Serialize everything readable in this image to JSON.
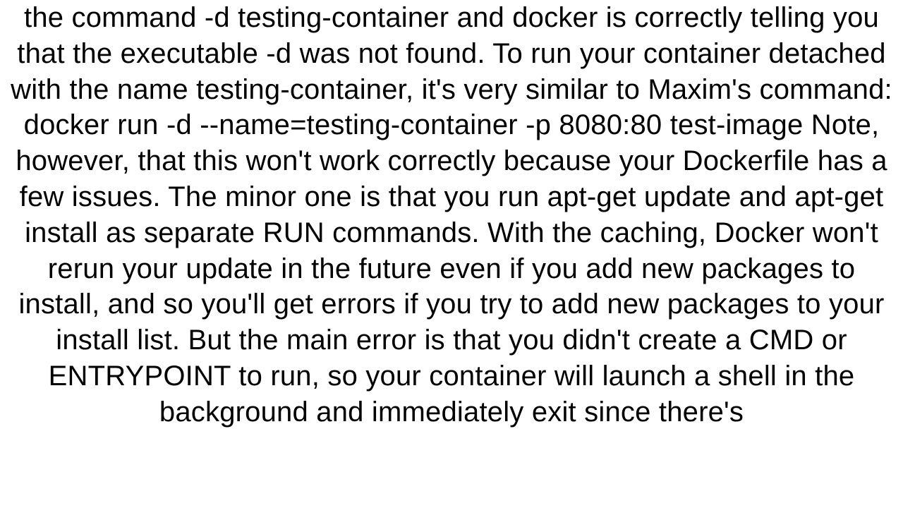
{
  "document": {
    "body_text": "the command -d testing-container and docker is correctly telling you that the executable -d was not found. To run your container detached with the name testing-container, it's very similar to Maxim's command: docker run -d --name=testing-container -p 8080:80 test-image  Note, however, that this won't work correctly because your Dockerfile has a few issues. The minor one is that you run apt-get update and apt-get install as separate RUN commands. With the caching, Docker won't rerun your update in the future even if you add new packages to install, and so you'll get errors if you try to add new packages to your install list. But the main error is that you didn't create a CMD or ENTRYPOINT to run, so your container will launch a shell in the background and immediately exit since there's"
  }
}
